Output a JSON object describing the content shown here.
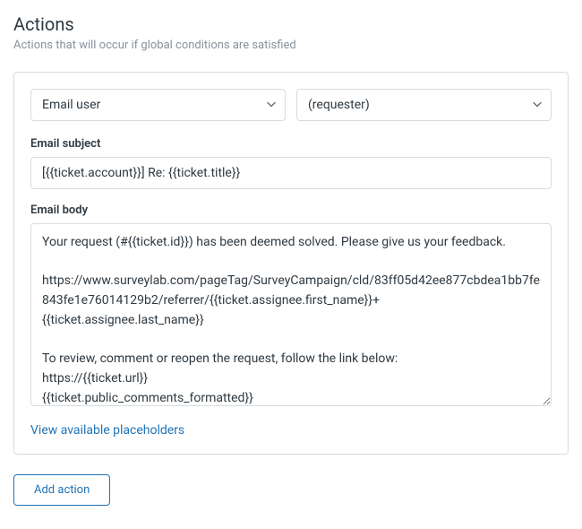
{
  "header": {
    "title": "Actions",
    "subtitle": "Actions that will occur if global conditions are satisfied"
  },
  "action": {
    "type_selected": "Email user",
    "recipient_selected": "(requester)",
    "subject_label": "Email subject",
    "subject_value": "[{{ticket.account}}] Re: {{ticket.title}}",
    "body_label": "Email body",
    "body_value": "Your request (#{{ticket.id}}) has been deemed solved. Please give us your feedback.\n\nhttps://www.surveylab.com/pageTag/SurveyCampaign/cld/83ff05d42ee877cbdea1bb7fe843fe1e76014129b2/referrer/{{ticket.assignee.first_name}}+{{ticket.assignee.last_name}}\n\nTo review, comment or reopen the request, follow the link below:\nhttps://{{ticket.url}}\n{{ticket.public_comments_formatted}}",
    "placeholders_link": "View available placeholders"
  },
  "buttons": {
    "add_action": "Add action"
  }
}
